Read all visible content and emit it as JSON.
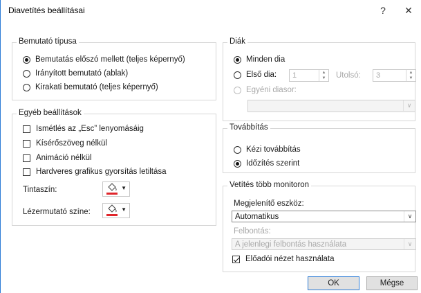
{
  "window": {
    "title": "Diavetítés beállításai",
    "help_label": "?",
    "close_label": "✕"
  },
  "show_type": {
    "legend": "Bemutató típusa",
    "options": [
      {
        "label": "Bemutatás előszó mellett (teljes képernyő)",
        "selected": true
      },
      {
        "label": "Irányított bemutató (ablak)",
        "selected": false
      },
      {
        "label": "Kirakati bemutató (teljes képernyő)",
        "selected": false
      }
    ]
  },
  "other_settings": {
    "legend": "Egyéb beállítások",
    "checks": [
      {
        "label": "Ismétlés az „Esc” lenyomásáig",
        "checked": false
      },
      {
        "label": "Kísérőszöveg nélkül",
        "checked": false
      },
      {
        "label": "Animáció nélkül",
        "checked": false
      },
      {
        "label": "Hardveres grafikus gyorsítás letiltása",
        "checked": false
      }
    ],
    "pen_color_label": "Tintaszín:",
    "laser_color_label": "Lézermutató színe:",
    "pen_color": "#e0262b",
    "laser_color": "#e0262b"
  },
  "slides": {
    "legend": "Diák",
    "all_label": "Minden dia",
    "from_label": "Első dia:",
    "from_value": "1",
    "to_label": "Utolsó:",
    "to_value": "3",
    "custom_label": "Egyéni diasor:",
    "custom_value": ""
  },
  "advance": {
    "legend": "Továbbítás",
    "manual_label": "Kézi továbbítás",
    "timings_label": "Időzítés szerint"
  },
  "monitors": {
    "legend": "Vetítés több monitoron",
    "display_label": "Megjelenítő eszköz:",
    "display_value": "Automatikus",
    "resolution_label": "Felbontás:",
    "resolution_value": "A jelenlegi felbontás használata",
    "presenter_view_label": "Előadói nézet használata"
  },
  "buttons": {
    "ok": "OK",
    "cancel": "Mégse"
  }
}
